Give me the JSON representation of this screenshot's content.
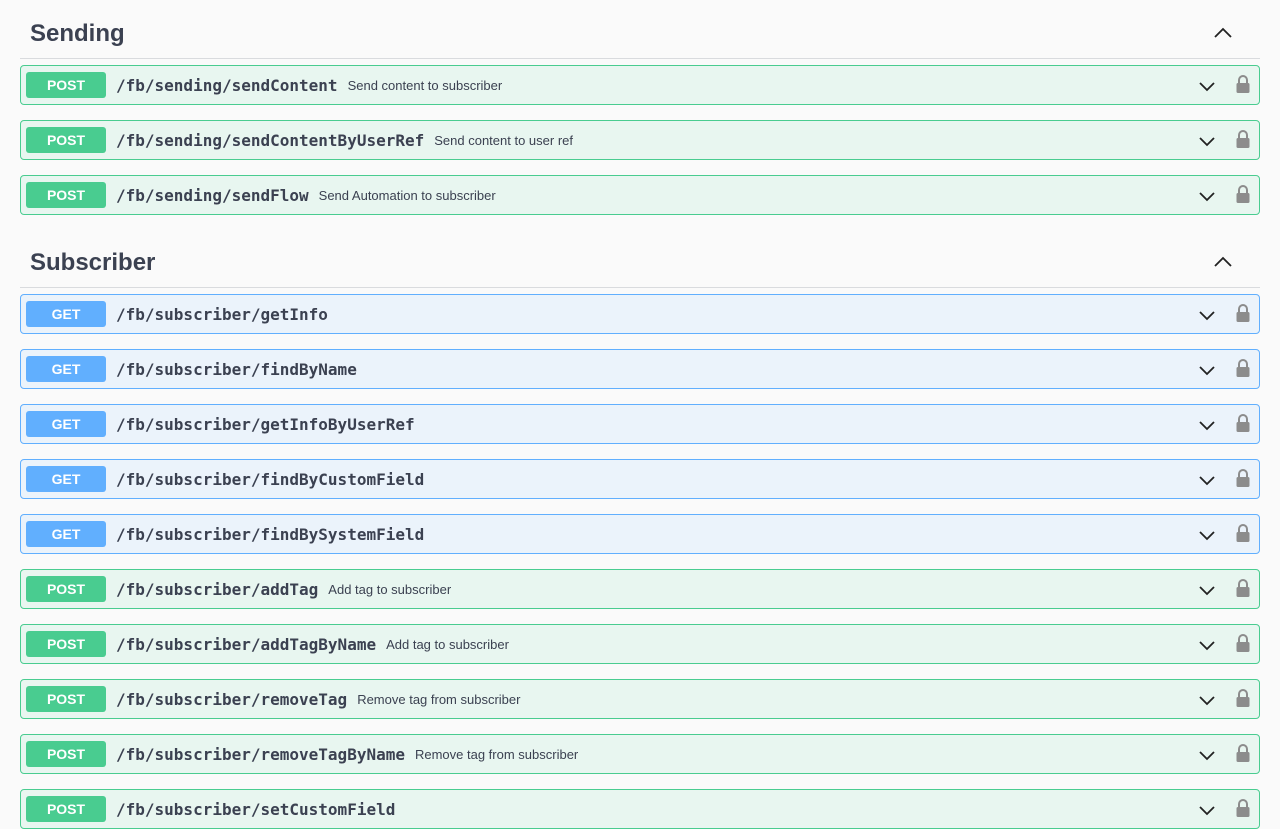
{
  "sections": [
    {
      "title": "Sending",
      "operations": [
        {
          "method": "POST",
          "path": "/fb/sending/sendContent",
          "summary": "Send content to subscriber"
        },
        {
          "method": "POST",
          "path": "/fb/sending/sendContentByUserRef",
          "summary": "Send content to user ref"
        },
        {
          "method": "POST",
          "path": "/fb/sending/sendFlow",
          "summary": "Send Automation to subscriber"
        }
      ]
    },
    {
      "title": "Subscriber",
      "operations": [
        {
          "method": "GET",
          "path": "/fb/subscriber/getInfo",
          "summary": ""
        },
        {
          "method": "GET",
          "path": "/fb/subscriber/findByName",
          "summary": ""
        },
        {
          "method": "GET",
          "path": "/fb/subscriber/getInfoByUserRef",
          "summary": ""
        },
        {
          "method": "GET",
          "path": "/fb/subscriber/findByCustomField",
          "summary": ""
        },
        {
          "method": "GET",
          "path": "/fb/subscriber/findBySystemField",
          "summary": ""
        },
        {
          "method": "POST",
          "path": "/fb/subscriber/addTag",
          "summary": "Add tag to subscriber"
        },
        {
          "method": "POST",
          "path": "/fb/subscriber/addTagByName",
          "summary": "Add tag to subscriber"
        },
        {
          "method": "POST",
          "path": "/fb/subscriber/removeTag",
          "summary": "Remove tag from subscriber"
        },
        {
          "method": "POST",
          "path": "/fb/subscriber/removeTagByName",
          "summary": "Remove tag from subscriber"
        },
        {
          "method": "POST",
          "path": "/fb/subscriber/setCustomField",
          "summary": ""
        }
      ]
    }
  ],
  "icons": {
    "collapse": "chevron-up-icon",
    "expand": "chevron-down-icon",
    "auth": "lock-icon"
  },
  "colors": {
    "post": "#49cc90",
    "get": "#61affe"
  }
}
